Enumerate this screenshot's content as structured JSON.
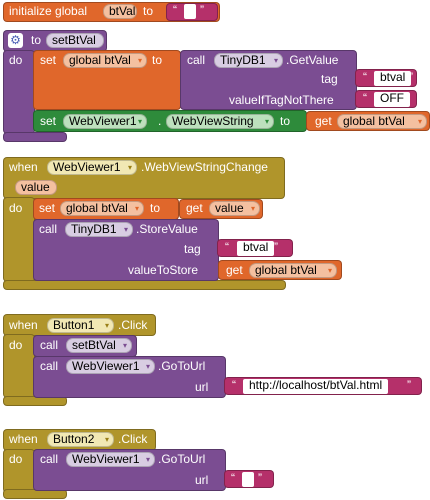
{
  "init_block": {
    "label": "initialize global",
    "var_name": "btVal",
    "to": "to",
    "value": ""
  },
  "proc_block": {
    "to": "to",
    "name": "setBtVal",
    "do": "do",
    "set_label": "set",
    "set_var": "global btVal",
    "set_to": "to",
    "call_label": "call",
    "call_component": "TinyDB1",
    "call_method": ".GetValue",
    "tag_label": "tag",
    "tag_value": "btval",
    "default_label": "valueIfTagNotThere",
    "default_value": "OFF",
    "set2_label": "set",
    "set2_component": "WebViewer1",
    "set2_dot": ".",
    "set2_property": "WebViewString",
    "set2_to": "to",
    "get_label": "get",
    "get_var": "global btVal"
  },
  "event1": {
    "when": "when",
    "component": "WebViewer1",
    "event": ".WebViewStringChange",
    "param": "value",
    "do": "do",
    "set_label": "set",
    "set_var": "global btVal",
    "set_to": "to",
    "get_label": "get",
    "get_var": "value",
    "call_label": "call",
    "call_component": "TinyDB1",
    "call_method": ".StoreValue",
    "tag_label": "tag",
    "tag_value": "btval",
    "store_label": "valueToStore",
    "store_get": "get",
    "store_var": "global btVal"
  },
  "event2": {
    "when": "when",
    "component": "Button1",
    "event": ".Click",
    "do": "do",
    "call1_label": "call",
    "call1_proc": "setBtVal",
    "call2_label": "call",
    "call2_component": "WebViewer1",
    "call2_method": ".GoToUrl",
    "url_label": "url",
    "url_value": "http://localhost/btVal.html"
  },
  "event3": {
    "when": "when",
    "component": "Button2",
    "event": ".Click",
    "do": "do",
    "call_label": "call",
    "call_component": "WebViewer1",
    "call_method": ".GoToUrl",
    "url_label": "url",
    "url_value": ""
  },
  "colors": {
    "variable": "#e0672b",
    "procedure": "#7b4d92",
    "component_set": "#2e8b3b",
    "event": "#b0952b",
    "text": "#b5306a"
  },
  "icons": {
    "dropdown": "▾",
    "gear": "⚙",
    "open_quote": "“",
    "close_quote": "”"
  }
}
